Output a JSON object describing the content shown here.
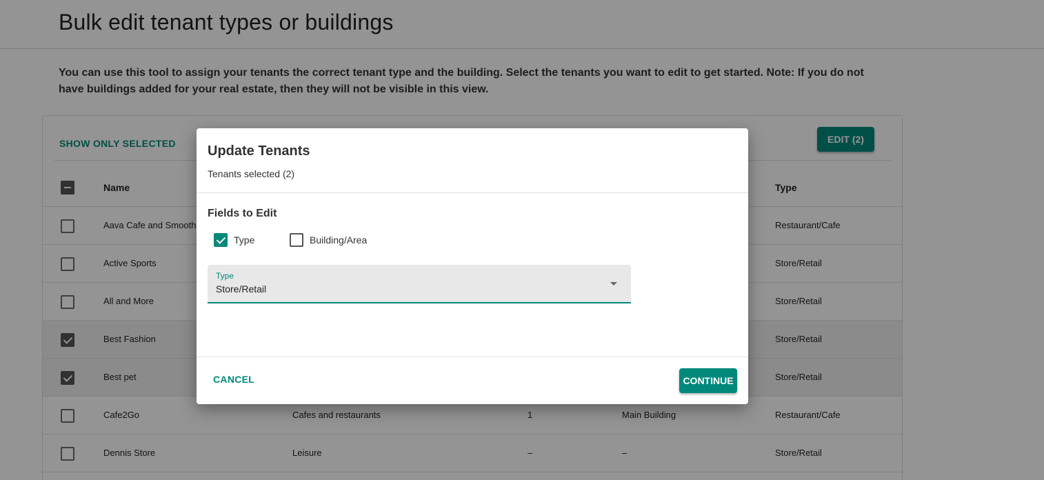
{
  "page": {
    "title": "Bulk edit tenant types or buildings",
    "intro": "You can use this tool to assign your tenants the correct tenant type and the building. Select the tenants you want to edit to get started. Note: If you do not have buildings added for your real estate, then they will not be visible in this view."
  },
  "toolbar": {
    "show_only_selected": "SHOW ONLY SELECTED",
    "edit_label": "EDIT (2)"
  },
  "table": {
    "columns": {
      "name": "Name",
      "type": "Type"
    },
    "rows": [
      {
        "name": "Aava Cafe and Smoothi",
        "category": "",
        "num": "",
        "building": "",
        "type": "Restaurant/Cafe",
        "selected": false
      },
      {
        "name": "Active Sports",
        "category": "",
        "num": "",
        "building": "",
        "type": "Store/Retail",
        "selected": false
      },
      {
        "name": "All and More",
        "category": "",
        "num": "",
        "building": "",
        "type": "Store/Retail",
        "selected": false
      },
      {
        "name": "Best Fashion",
        "category": "",
        "num": "",
        "building": "",
        "type": "Store/Retail",
        "selected": true
      },
      {
        "name": "Best pet",
        "category": "",
        "num": "",
        "building": "",
        "type": "Store/Retail",
        "selected": true
      },
      {
        "name": "Cafe2Go",
        "category": "Cafes and restaurants",
        "num": "1",
        "building": "Main Building",
        "type": "Restaurant/Cafe",
        "selected": false
      },
      {
        "name": "Dennis Store",
        "category": "Leisure",
        "num": "–",
        "building": "–",
        "type": "Store/Retail",
        "selected": false
      }
    ]
  },
  "dialog": {
    "title": "Update Tenants",
    "subtitle": "Tenants selected (2)",
    "fields_heading": "Fields to Edit",
    "options": [
      {
        "label": "Type",
        "checked": true
      },
      {
        "label": "Building/Area",
        "checked": false
      }
    ],
    "select": {
      "label": "Type",
      "value": "Store/Retail"
    },
    "cancel_label": "CANCEL",
    "continue_label": "CONTINUE"
  },
  "colors": {
    "accent": "#00897b",
    "scrim": "rgba(0,0,0,0.42)"
  }
}
